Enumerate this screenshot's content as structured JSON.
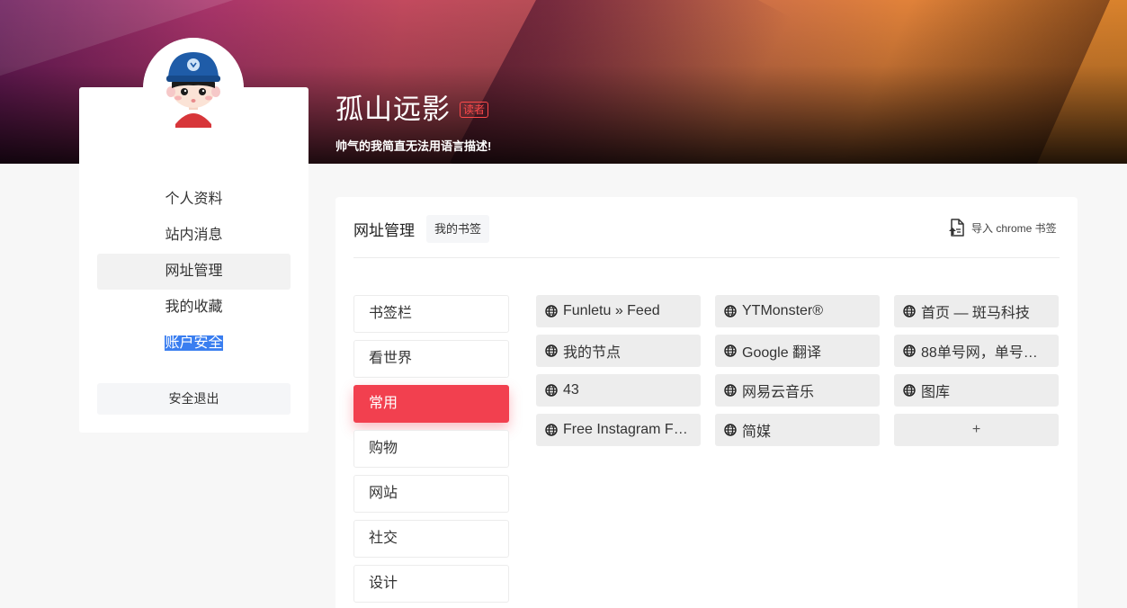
{
  "profile": {
    "name": "孤山远影",
    "role": "读者",
    "motto": "帅气的我简直无法用语言描述!"
  },
  "side_nav": {
    "items": [
      {
        "label": "个人资料"
      },
      {
        "label": "站内消息"
      },
      {
        "label": "网址管理"
      },
      {
        "label": "我的收藏"
      },
      {
        "label": "账户安全"
      }
    ],
    "logout_label": "安全退出"
  },
  "main": {
    "title": "网址管理",
    "tag": "我的书签",
    "import_label": "导入 chrome 书签"
  },
  "categories": [
    {
      "label": "书签栏"
    },
    {
      "label": "看世界"
    },
    {
      "label": "常用"
    },
    {
      "label": "购物"
    },
    {
      "label": "网站"
    },
    {
      "label": "社交"
    },
    {
      "label": "设计"
    }
  ],
  "links": [
    {
      "label": "Funletu » Feed"
    },
    {
      "label": "YTMonster®"
    },
    {
      "label": "首页 — 斑马科技"
    },
    {
      "label": "我的节点"
    },
    {
      "label": "Google 翻译"
    },
    {
      "label": "88单号网，单号…"
    },
    {
      "label": "43"
    },
    {
      "label": "网易云音乐"
    },
    {
      "label": "图库"
    },
    {
      "label": "Free Instagram F…"
    },
    {
      "label": "简媒"
    }
  ],
  "add_label": "+",
  "colors": {
    "accent": "#f2404f",
    "selection": "#3a7ef0",
    "role_badge": "#ff4a4a"
  }
}
